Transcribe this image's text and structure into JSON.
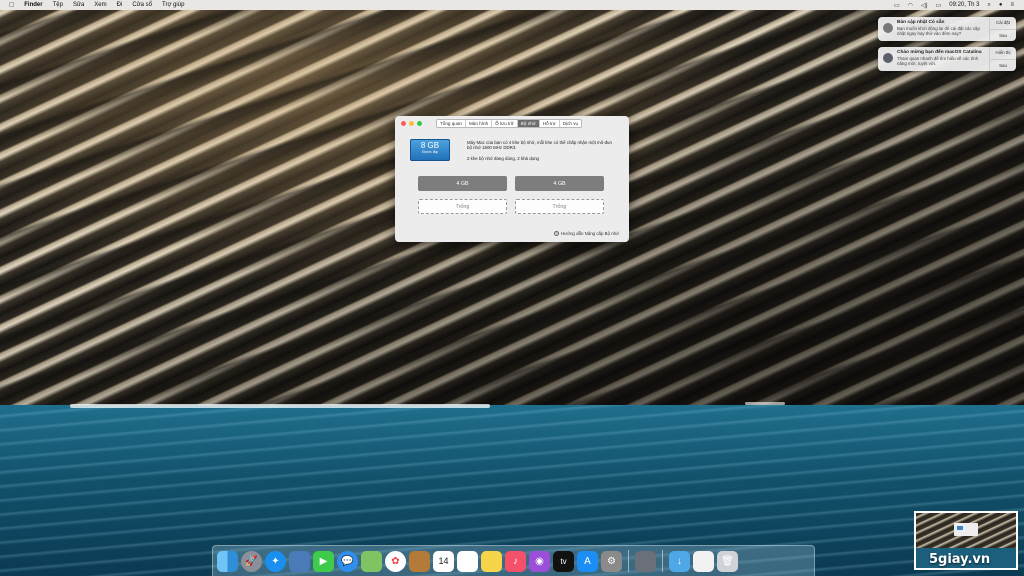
{
  "menubar": {
    "apple_icon": "apple-icon",
    "app": "Finder",
    "items": [
      "Tệp",
      "Sửa",
      "Xem",
      "Đi",
      "Cửa sổ",
      "Trợ giúp"
    ],
    "clock": "09:20, Th 3"
  },
  "notifications": [
    {
      "title": "Bản cập nhật Có sẵn",
      "body": "Bạn muốn khởi động lại để cài đặt các cập nhật ngay hay thử vào đêm nay?",
      "action1": "Cài đặt",
      "action2": "Sau"
    },
    {
      "title": "Chào mừng bạn đến macOS Catalina",
      "body": "Tham quan nhanh để tìm hiểu về các tính năng mới, tuyệt vời.",
      "action1": "Hiển thị",
      "action2": "Sau"
    }
  ],
  "window": {
    "tabs": [
      "Tổng quan",
      "Màn hình",
      "Ổ lưu trữ",
      "Bộ nhớ",
      "Hỗ trợ",
      "Dịch vụ"
    ],
    "active_tab": "Bộ nhớ",
    "badge_value": "8 GB",
    "badge_label": "Được lắp",
    "description": "Máy Mac của bạn có 4 khe bộ nhớ, mỗi khe có thể chấp nhận một mô-đun bộ nhớ 1600 MHz DDR3.",
    "slots_info": "2 khe bộ nhớ đang dùng, 2 khả dụng",
    "slots": [
      "4 GB",
      "4 GB",
      "Trống",
      "Trống"
    ],
    "help_link": "Hướng dẫn Nâng cấp Bộ nhớ"
  },
  "watermark": "5giay.vn",
  "calendar_date": "14"
}
